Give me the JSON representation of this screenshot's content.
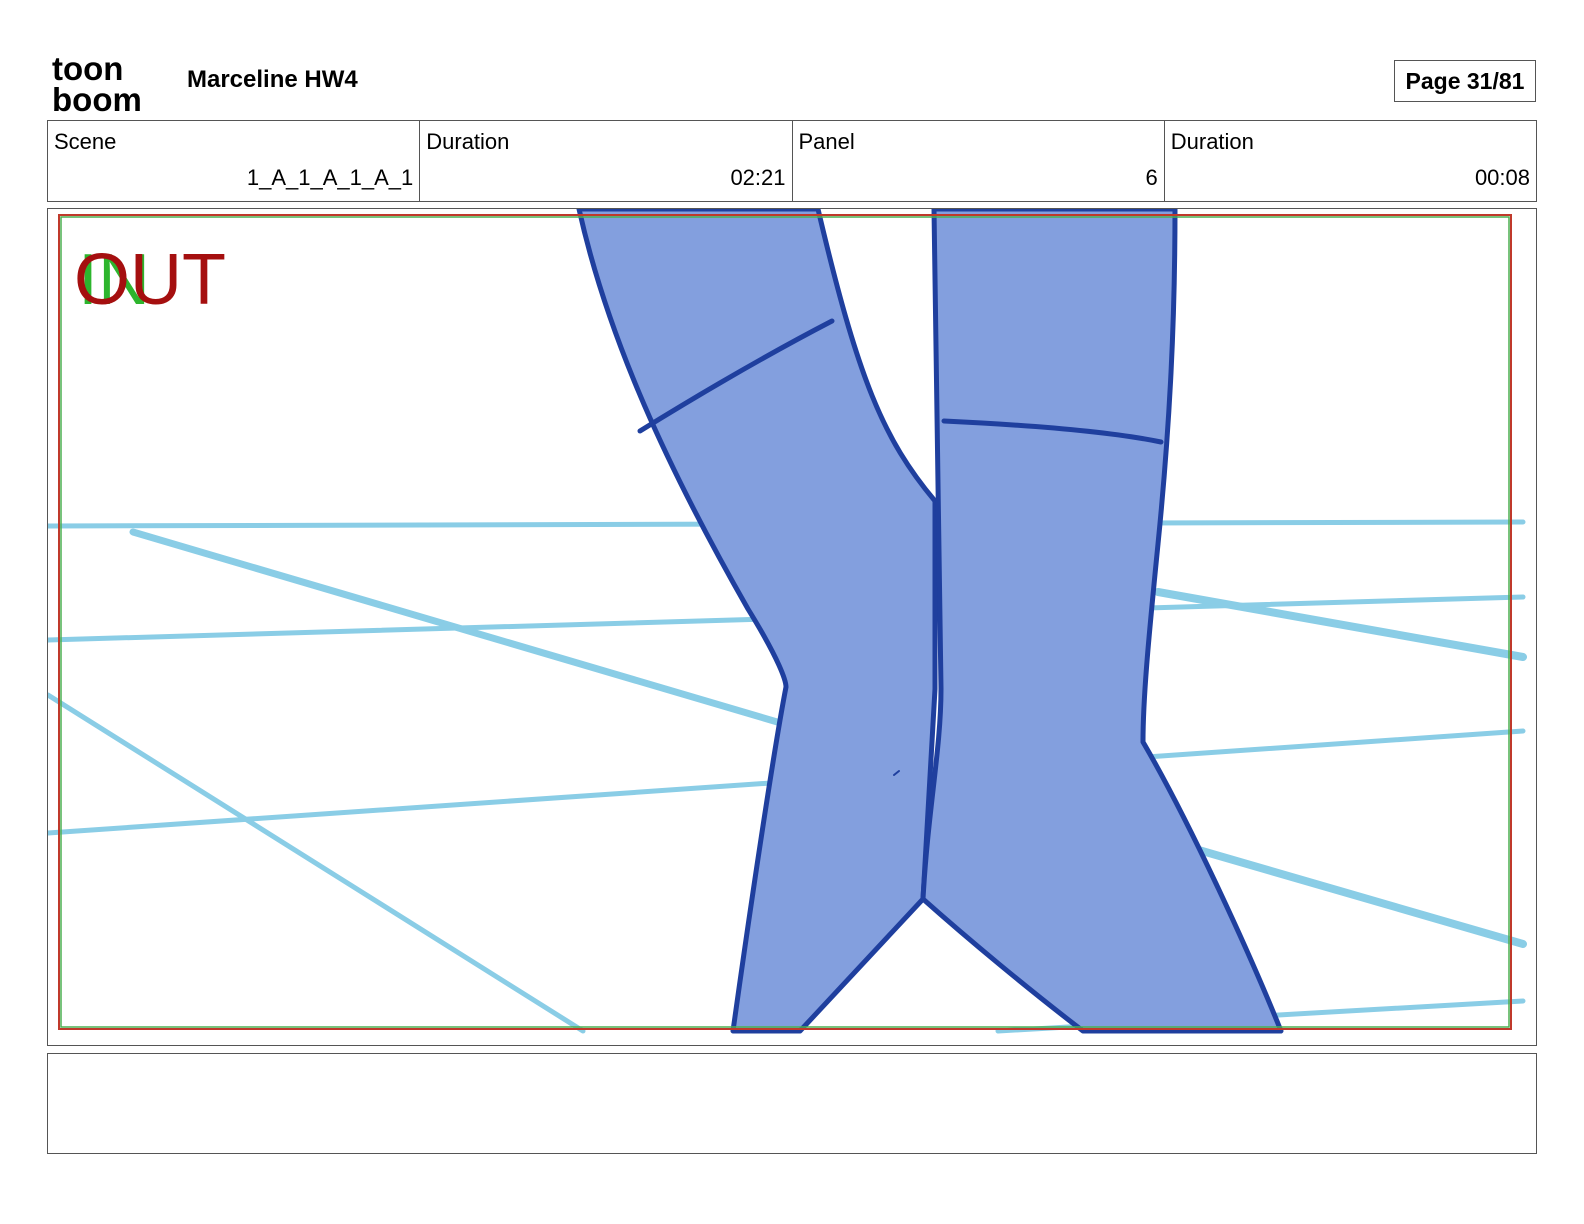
{
  "header": {
    "logo_text_top": "toon",
    "logo_text_bottom": "boom",
    "project_title": "Marceline HW4",
    "page_label": "Page 31/81"
  },
  "info": {
    "scene_label": "Scene",
    "scene_value": "1_A_1_A_1_A_1",
    "scene_duration_label": "Duration",
    "scene_duration_value": "02:21",
    "panel_label": "Panel",
    "panel_value": "6",
    "panel_duration_label": "Duration",
    "panel_duration_value": "00:08"
  },
  "panel": {
    "marker_in": "IN",
    "marker_out": "OUT",
    "colors": {
      "leg_fill": "#839FDE",
      "leg_outline": "#1F3F9E",
      "floor_lines": "#8ACDE6",
      "out_marker": "#A50F0F",
      "in_marker": "#2DB52D",
      "safe_frame_red": "#C0392B",
      "safe_frame_green": "#4CAF50"
    }
  },
  "notes": {
    "text": ""
  }
}
